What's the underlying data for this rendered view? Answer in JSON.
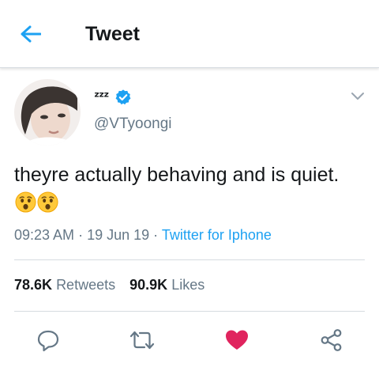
{
  "header": {
    "back_icon": "arrow-left-icon",
    "title": "Tweet"
  },
  "colors": {
    "accent": "#1da1f2",
    "like": "#e0245e",
    "muted": "#657786",
    "text": "#14171a"
  },
  "author": {
    "avatar_icon": "profile-photo",
    "display_name": "ᶻᶻᶻ",
    "verified_icon": "verified-badge-icon",
    "handle": "@VTyoongi",
    "menu_icon": "chevron-down-icon"
  },
  "tweet": {
    "text": "theyre actually behaving and is quiet.",
    "emojis": [
      "hushed-face",
      "hushed-face"
    ]
  },
  "meta": {
    "time": "09:23 AM",
    "sep1": " · ",
    "date": "19 Jun 19",
    "sep2": " · ",
    "source": "Twitter for Iphone"
  },
  "stats": {
    "retweets_count": "78.6K",
    "retweets_label": "Retweets",
    "likes_count": "90.9K",
    "likes_label": "Likes"
  },
  "actions": {
    "reply_icon": "reply-icon",
    "retweet_icon": "retweet-icon",
    "like_icon": "heart-icon",
    "share_icon": "share-icon",
    "liked": true
  }
}
